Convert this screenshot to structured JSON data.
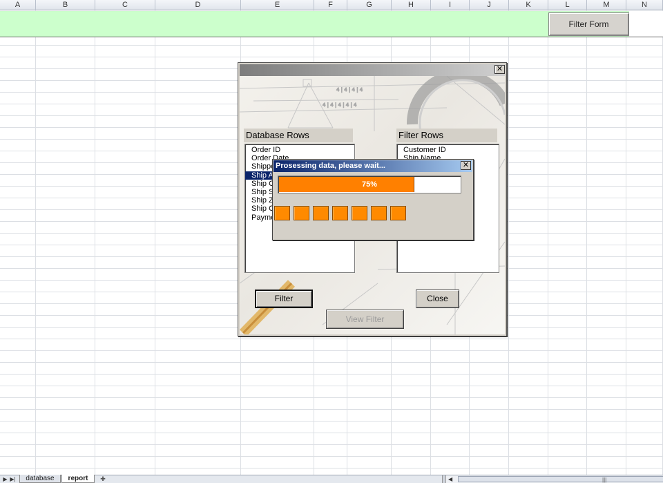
{
  "columns": [
    "A",
    "B",
    "C",
    "D",
    "E",
    "F",
    "G",
    "H",
    "I",
    "J",
    "K",
    "L",
    "M",
    "N"
  ],
  "banner": {
    "filter_form_button": "Filter Form",
    "background_color": "#ccffcc"
  },
  "main_form": {
    "close_icon": "close-icon",
    "database_rows_label": "Database Rows",
    "filter_rows_label": "Filter Rows",
    "database_rows": [
      "Order ID",
      "Order Date",
      "Shippe",
      "Ship A",
      "Ship C",
      "Ship S",
      "Ship Z",
      "Ship C",
      "Payme"
    ],
    "database_selected_index": 3,
    "filter_rows": [
      "Customer ID",
      "Ship Name"
    ],
    "filter_button": "Filter",
    "close_button": "Close",
    "view_filter_button": "View Filter"
  },
  "progress_dialog": {
    "title": "Prosessing data, please wait...",
    "percent_text": "75%",
    "progress_fraction": 0.75,
    "block_count": 7,
    "bar_color": "#ff8000"
  },
  "sheets": {
    "tabs": [
      "database",
      "report"
    ],
    "active": "report"
  }
}
